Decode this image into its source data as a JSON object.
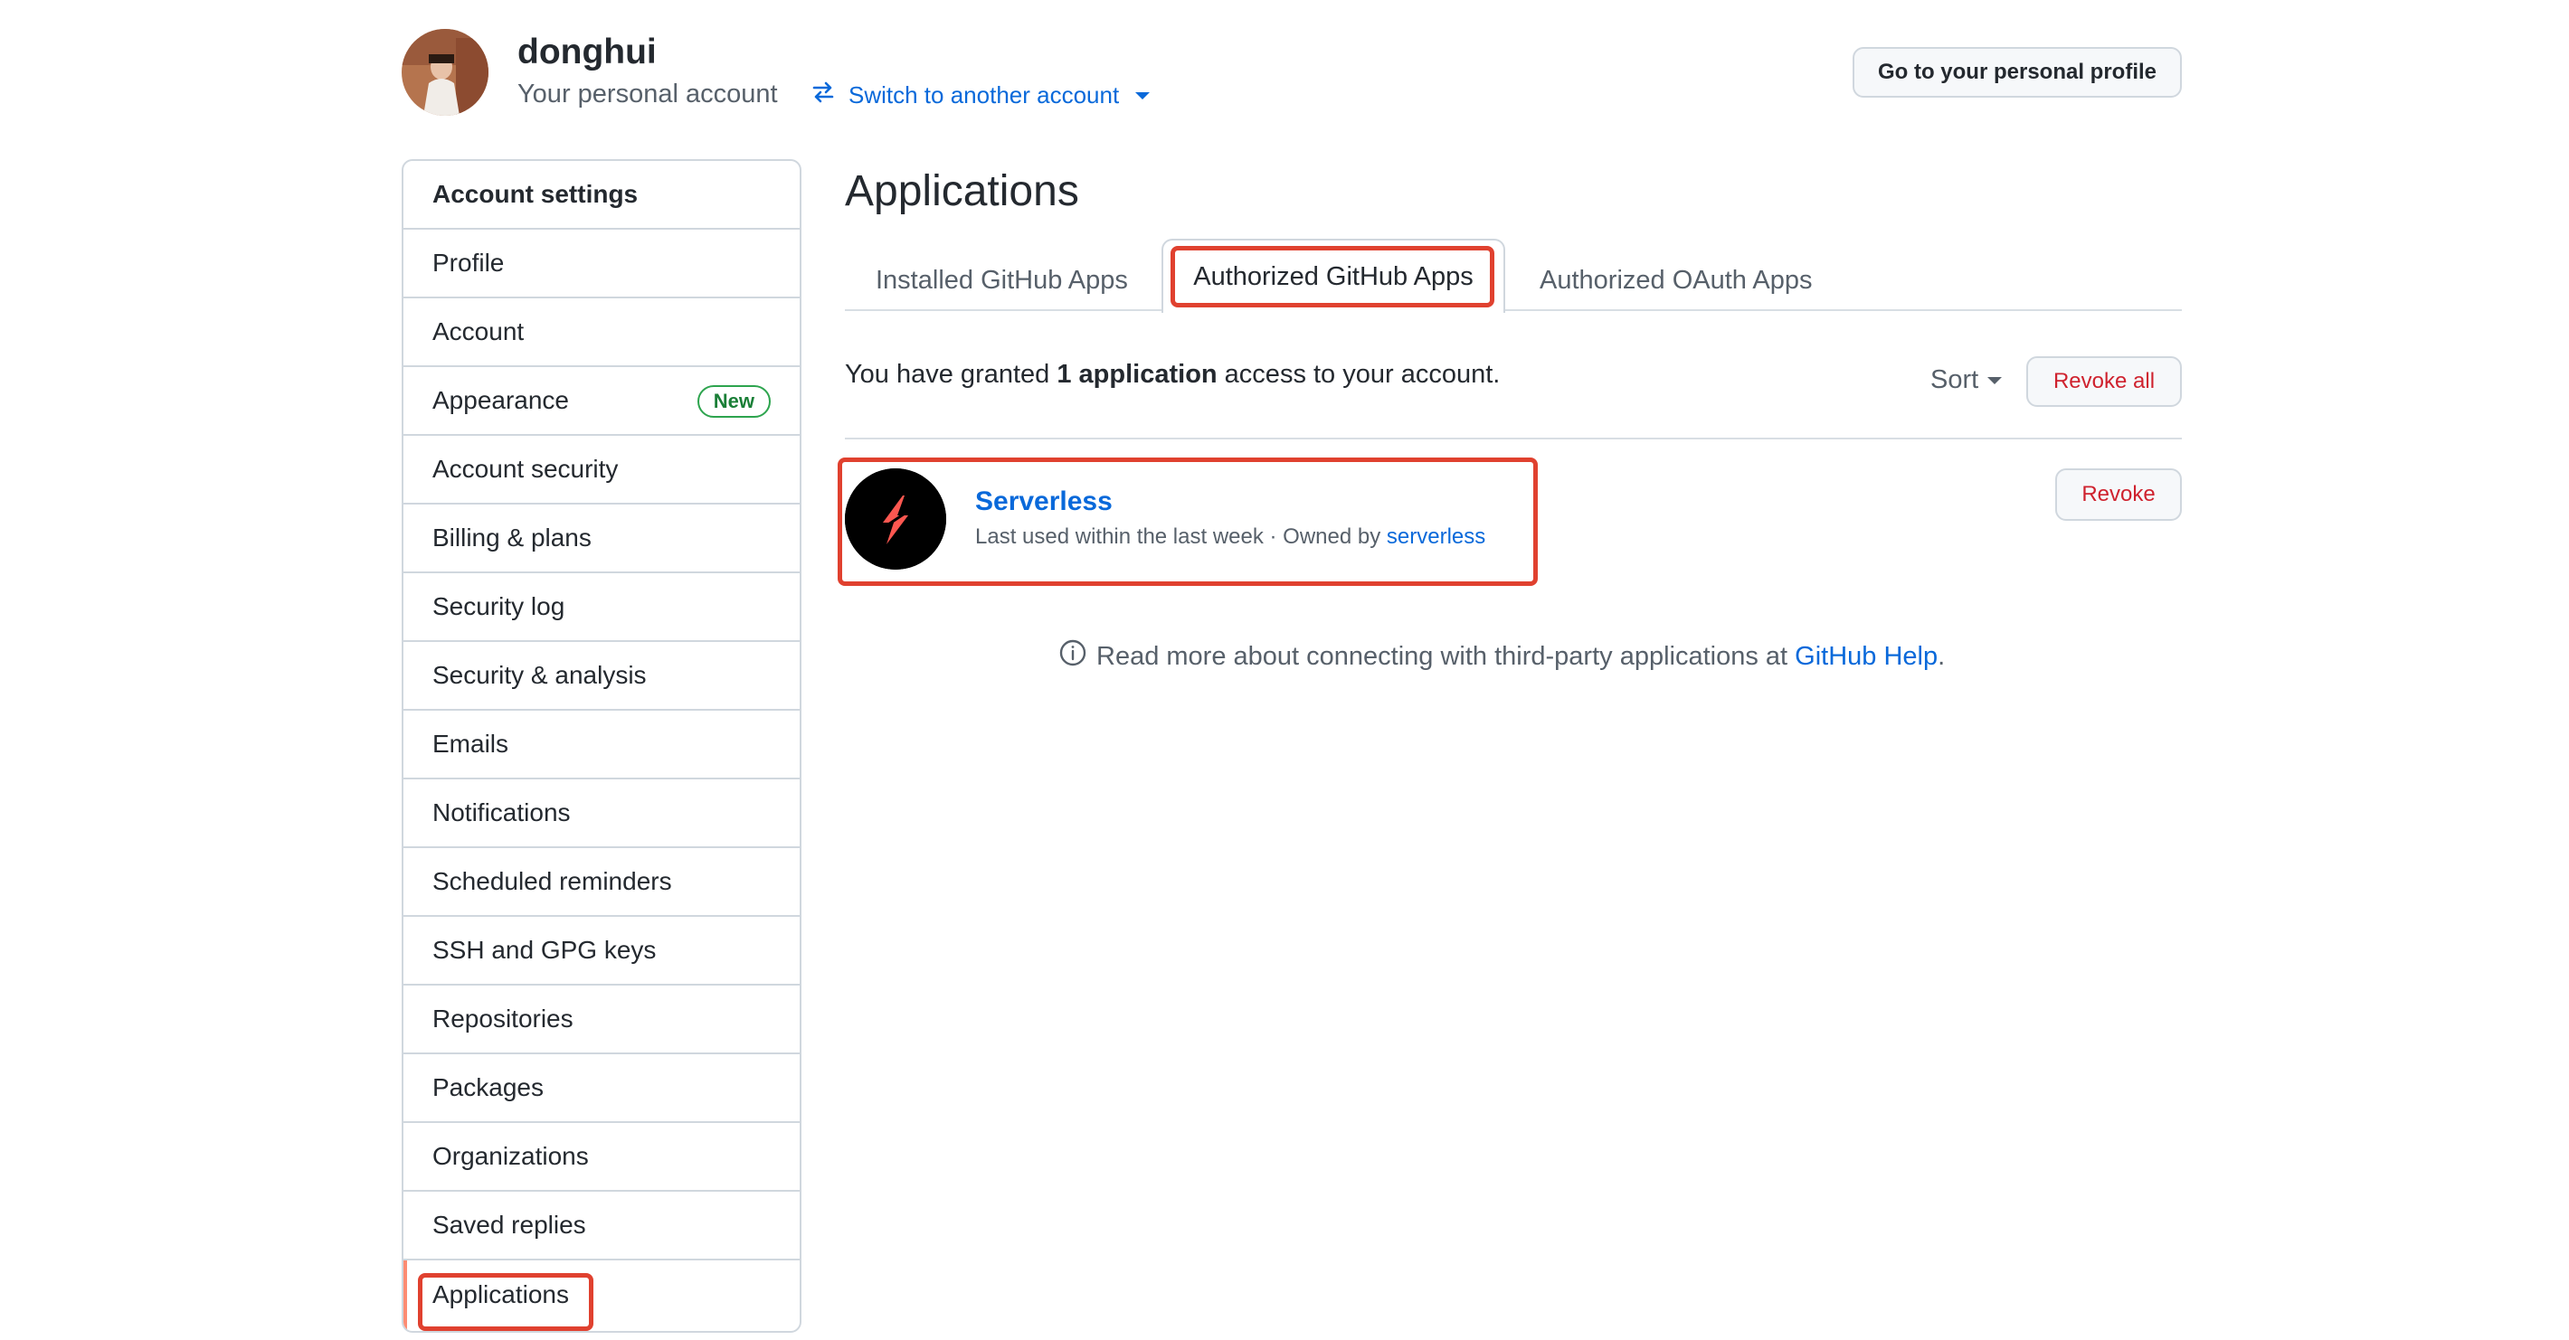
{
  "header": {
    "username": "donghui",
    "subtitle": "Your personal account",
    "switch_label": "Switch to another account",
    "profile_button": "Go to your personal profile"
  },
  "sidebar": {
    "title": "Account settings",
    "items": [
      {
        "label": "Profile"
      },
      {
        "label": "Account"
      },
      {
        "label": "Appearance",
        "badge": "New"
      },
      {
        "label": "Account security"
      },
      {
        "label": "Billing & plans"
      },
      {
        "label": "Security log"
      },
      {
        "label": "Security & analysis"
      },
      {
        "label": "Emails"
      },
      {
        "label": "Notifications"
      },
      {
        "label": "Scheduled reminders"
      },
      {
        "label": "SSH and GPG keys"
      },
      {
        "label": "Repositories"
      },
      {
        "label": "Packages"
      },
      {
        "label": "Organizations"
      },
      {
        "label": "Saved replies"
      },
      {
        "label": "Applications",
        "active": true
      }
    ]
  },
  "main": {
    "title": "Applications",
    "tabs": [
      {
        "label": "Installed GitHub Apps"
      },
      {
        "label": "Authorized GitHub Apps",
        "active": true
      },
      {
        "label": "Authorized OAuth Apps"
      }
    ],
    "granted_prefix": "You have granted ",
    "granted_count": "1 application",
    "granted_suffix": " access to your account.",
    "sort_label": "Sort",
    "revoke_all_label": "Revoke all",
    "app": {
      "name": "Serverless",
      "meta_prefix": "Last used within the last week · Owned by ",
      "owner": "serverless",
      "revoke_label": "Revoke"
    },
    "info_prefix": "Read more about connecting with third-party applications at ",
    "info_link": "GitHub Help",
    "info_suffix": "."
  },
  "colors": {
    "link": "#0969da",
    "danger": "#cf222e",
    "highlight": "#e0412f",
    "badge_green": "#1a7f37"
  }
}
